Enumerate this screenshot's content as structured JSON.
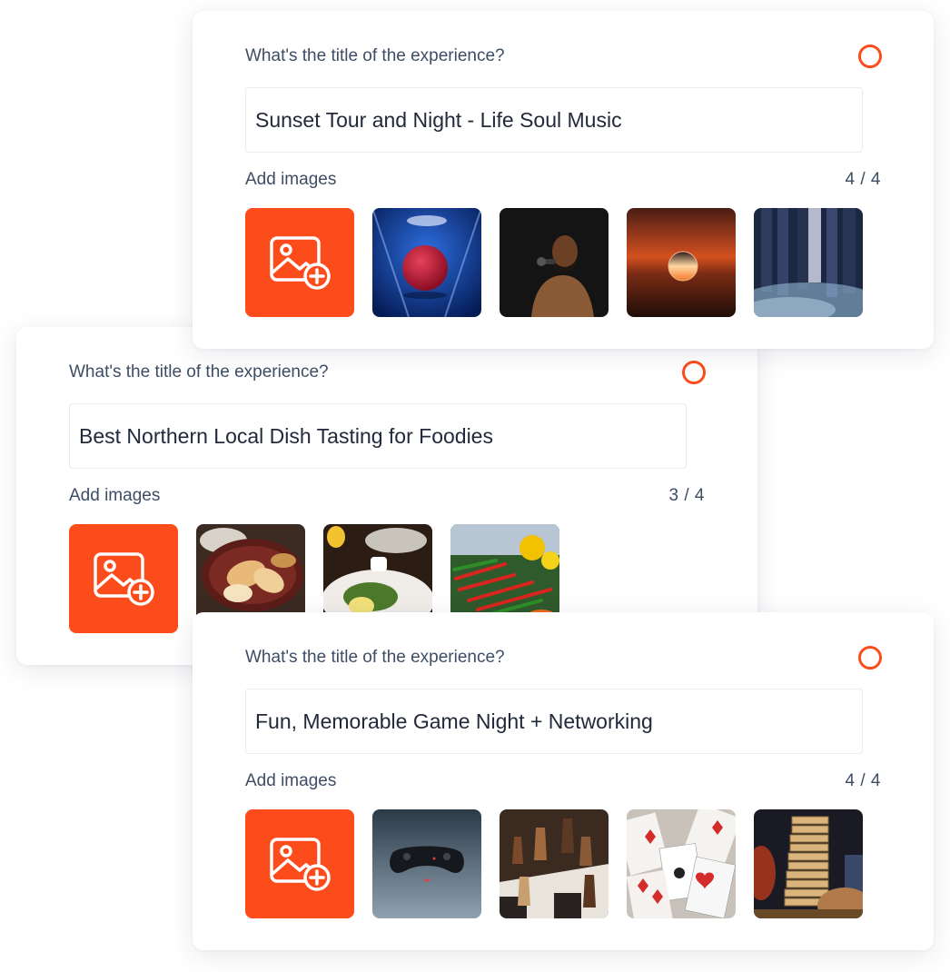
{
  "cards": [
    {
      "question": "What's the title of the experience?",
      "title_value": "Sunset Tour and Night - Life Soul Music",
      "images_label": "Add images",
      "image_count": "4 / 4",
      "images": [
        "bowling-ball-photo",
        "singer-photo",
        "sunset-glass-ball-photo",
        "dancers-smoke-photo"
      ]
    },
    {
      "question": "What's the title of the experience?",
      "title_value": "Best Northern Local Dish Tasting for Foodies",
      "images_label": "Add images",
      "image_count": "3 / 4",
      "images": [
        "bread-basket-photo",
        "brunch-plates-photo",
        "chili-peppers-photo"
      ]
    },
    {
      "question": "What's the title of the experience?",
      "title_value": "Fun, Memorable Game Night + Networking",
      "images_label": "Add images",
      "image_count": "4 / 4",
      "images": [
        "game-controller-photo",
        "chess-pieces-photo",
        "playing-cards-photo",
        "jenga-tower-photo"
      ]
    }
  ],
  "icons": {
    "add_image": "image-plus-icon",
    "radio": "radio-circle"
  },
  "colors": {
    "accent": "#fc4c1b",
    "text": "#3d4d66",
    "input_text": "#22293a"
  }
}
